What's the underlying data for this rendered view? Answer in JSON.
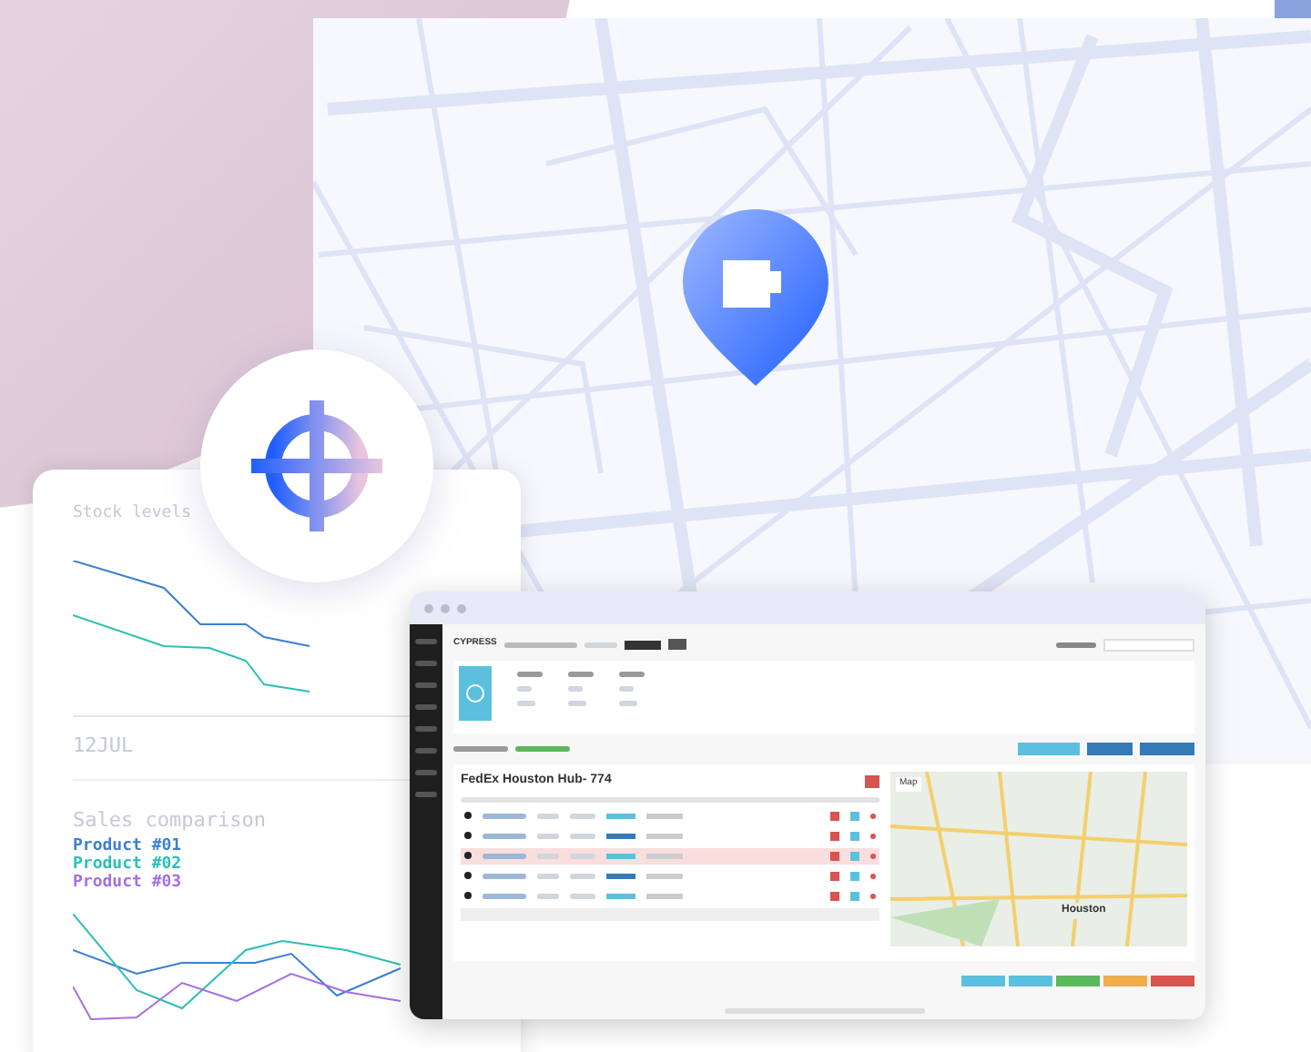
{
  "stock_card": {
    "title": "Stock levels",
    "date": "12JUL"
  },
  "sales_card": {
    "title": "Sales comparison",
    "legend": [
      {
        "label": "Product #01",
        "color": "#3b7fd4"
      },
      {
        "label": "Product #02",
        "color": "#2bbfb5"
      },
      {
        "label": "Product #03",
        "color": "#a66fe0"
      }
    ]
  },
  "app": {
    "brand": "CYPRESS",
    "hub_title": "FedEx Houston Hub- 774",
    "rows": [
      {
        "highlighted": false
      },
      {
        "highlighted": false
      },
      {
        "highlighted": true
      },
      {
        "highlighted": false
      },
      {
        "highlighted": false
      }
    ],
    "map": {
      "type_button": "Map",
      "city_label": "Houston"
    }
  }
}
